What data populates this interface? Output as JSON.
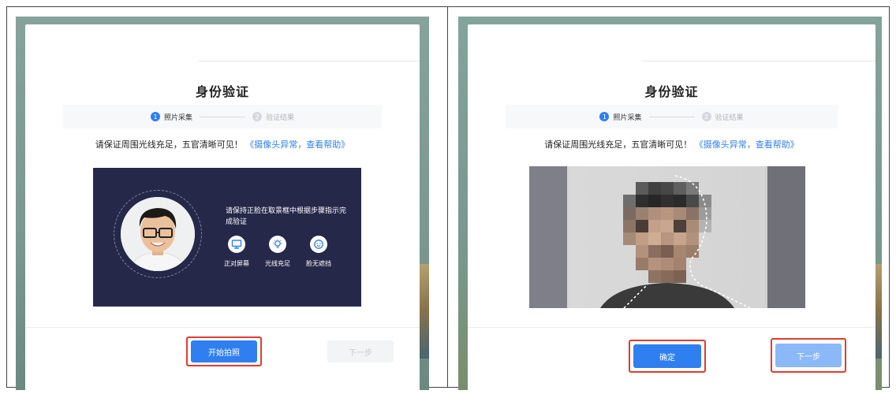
{
  "left_screen": {
    "dialog": {
      "title": "身份验证",
      "steps": [
        {
          "num": "1",
          "label": "照片采集",
          "state": "active"
        },
        {
          "num": "2",
          "label": "验证结果",
          "state": "inactive"
        }
      ],
      "hint_text": "请保证周围光线充足，五官清晰可见！",
      "hint_link": "《摄像头异常，查看帮助》",
      "guide": {
        "instruction": "请保持正脸在取景框中根据步骤指示完成验证",
        "tips": [
          {
            "icon": "monitor-icon",
            "label": "正对屏幕"
          },
          {
            "icon": "lightbulb-icon",
            "label": "光线充足"
          },
          {
            "icon": "face-icon",
            "label": "脸无遮挡"
          }
        ]
      },
      "buttons": {
        "start_label": "开始拍照",
        "next_label": "下一步",
        "next_state": "disabled"
      }
    }
  },
  "right_screen": {
    "dialog": {
      "title": "身份验证",
      "steps": [
        {
          "num": "1",
          "label": "照片采集",
          "state": "active"
        },
        {
          "num": "2",
          "label": "验证结果",
          "state": "inactive"
        }
      ],
      "hint_text": "请保证周围光线充足，五官清晰可见！",
      "hint_link": "《摄像头异常，查看帮助》",
      "camera_feed": "pixelated-face",
      "buttons": {
        "confirm_label": "确定",
        "next_label": "下一步",
        "next_state": "inactive"
      }
    }
  },
  "colors": {
    "accent": "#2f7ff0",
    "panel_bg": "#26284a",
    "highlight": "#e23b2e",
    "backdrop": "#7b978f"
  }
}
